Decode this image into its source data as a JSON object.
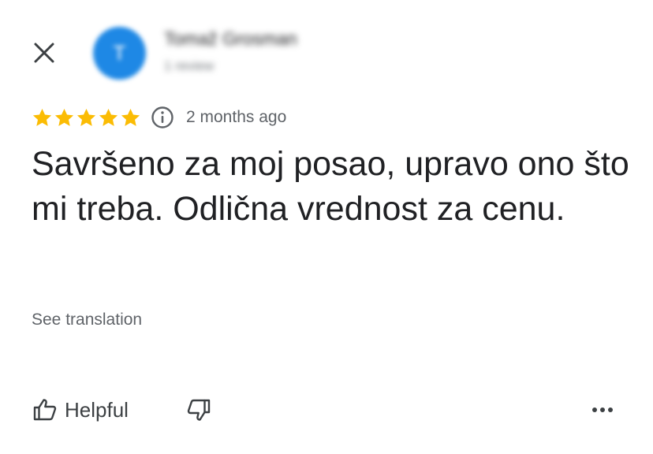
{
  "header": {
    "close_icon": "close-icon",
    "author": {
      "name": "Tomaž Grosman",
      "meta": "1 review",
      "avatar_initial": "T",
      "avatar_color": "#1e88e5"
    }
  },
  "review": {
    "rating": 5,
    "rating_max": 5,
    "star_color": "#fbbc04",
    "info_icon": "info-icon",
    "time_ago": "2 months ago",
    "text": "Savršeno za moj posao, upravo ono što mi treba. Odlična vrednost za cenu.",
    "see_translation": "See translation"
  },
  "actions": {
    "helpful_label": "Helpful",
    "helpful_icon": "thumbs-up-icon",
    "not_helpful_icon": "thumbs-down-icon",
    "more_icon": "more-horizontal-icon"
  }
}
